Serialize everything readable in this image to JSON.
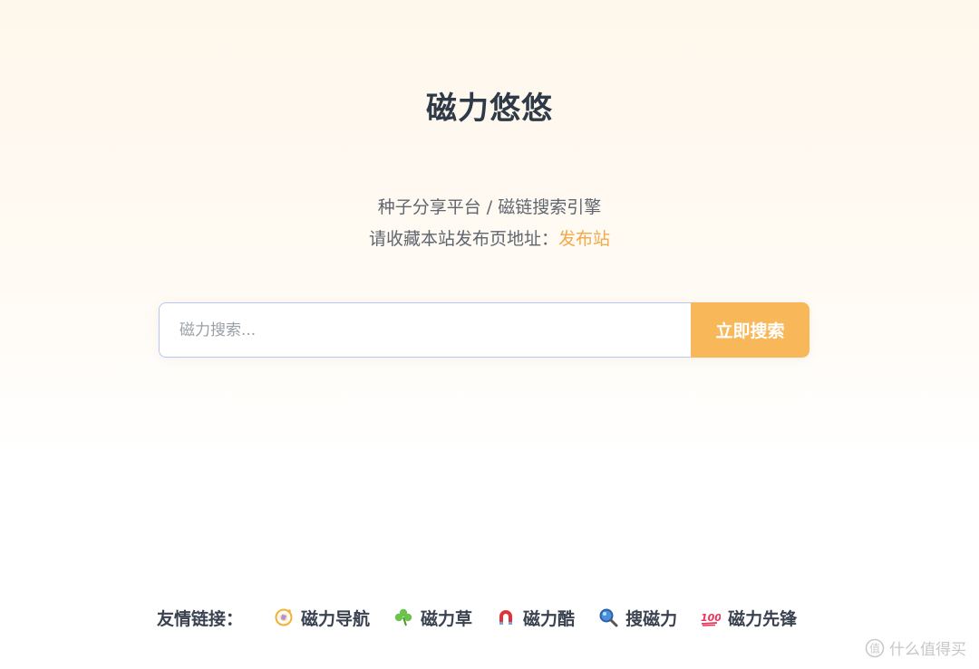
{
  "header": {
    "title": "磁力悠悠"
  },
  "intro": {
    "tagline": "种子分享平台 / 磁链搜索引擎",
    "notice_prefix": "请收藏本站发布页地址：",
    "publish_link": "发布站"
  },
  "search": {
    "placeholder": "磁力搜索...",
    "value": "",
    "button_label": "立即搜索"
  },
  "footer": {
    "friend_label": "友情链接：",
    "links": [
      {
        "label": "磁力导航",
        "icon": "compass-icon"
      },
      {
        "label": "磁力草",
        "icon": "clover-icon"
      },
      {
        "label": "磁力酷",
        "icon": "magnet-icon"
      },
      {
        "label": "搜磁力",
        "icon": "magnifier-icon"
      },
      {
        "label": "磁力先锋",
        "icon": "hundred-icon"
      }
    ]
  },
  "watermark": {
    "text": "什么值得买"
  },
  "colors": {
    "accent": "#f8b85a",
    "link": "#f3a94b",
    "title": "#2f3a48"
  }
}
